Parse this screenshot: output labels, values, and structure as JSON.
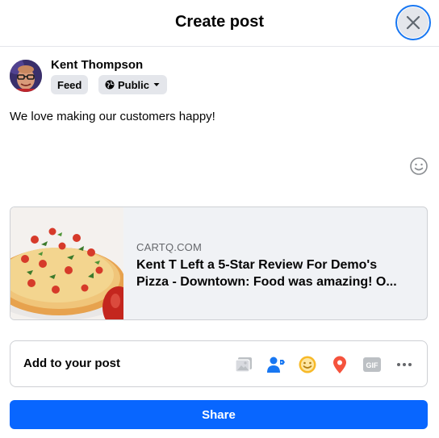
{
  "dialog": {
    "title": "Create post"
  },
  "author": {
    "name": "Kent Thompson",
    "audience_feed": "Feed",
    "privacy_label": "Public"
  },
  "post": {
    "text": "We love making our customers happy!"
  },
  "link_preview": {
    "domain": "CARTQ.COM",
    "title_line1": "Kent T Left a 5-Star Review For Demo's",
    "title_line2": "Pizza - Downtown: Food was amazing! O..."
  },
  "add_to_post": {
    "label": "Add to your post",
    "icons": [
      "photo-video-icon",
      "tag-people-icon",
      "feeling-icon",
      "check-in-icon",
      "gif-icon",
      "more-icon"
    ]
  },
  "actions": {
    "share_label": "Share"
  },
  "colors": {
    "primary": "#0866ff",
    "focus_ring": "#1877f2",
    "feeling": "#f7b928",
    "check_in": "#f5533d",
    "tag_people": "#1877f2",
    "disabled_icon": "#bcc0c4"
  }
}
